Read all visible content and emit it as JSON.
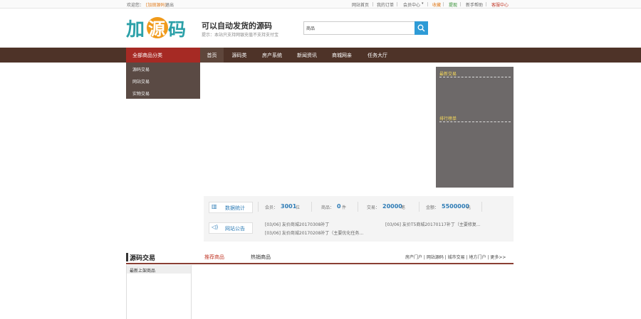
{
  "topbar": {
    "welcome": "欢迎您：",
    "username": "[加田源码]",
    "logout": "退出",
    "links": [
      "网站首页",
      "我的订单",
      "会员中心",
      "收藏",
      "提现",
      "新手帮助",
      "客服中心"
    ],
    "member_dropdown_icon": "caret-down-icon"
  },
  "header": {
    "logo_text": "加源码",
    "slogan": "可以自动发货的源码",
    "sub": "提示：本站只支持网银充值不支持支付宝",
    "search": {
      "category": "商品",
      "placeholder": "",
      "icon": "search-icon"
    }
  },
  "nav": {
    "category_head": "全部商品分类",
    "items": [
      "首页",
      "源码类",
      "房产系统",
      "新闻资讯",
      "商城网亲",
      "任务大厅"
    ],
    "categories": [
      "源码交易",
      "网站交易",
      "实物交易"
    ]
  },
  "side": {
    "latest": "最新交易",
    "rank": "排行榜单"
  },
  "stats": {
    "stats_label": "数据统计",
    "notice_label": "网站公告",
    "items": [
      {
        "label": "会员：",
        "value": "3001",
        "unit": "位"
      },
      {
        "label": "商品：",
        "value": "0",
        "unit": "件"
      },
      {
        "label": "交易：",
        "value": "20000",
        "unit": "笔"
      },
      {
        "label": "金额：",
        "value": "5500000",
        "unit": "元"
      }
    ],
    "notices": [
      "[03/06] 友价商城20170308补丁",
      "[03/06] 友价T5商城20170117补丁（主要修复...",
      "[03/06] 友价商城20170208补丁（主要优化任务..."
    ]
  },
  "section": {
    "title": "源码交易",
    "tabs": [
      "推荐商品",
      "热销商品"
    ],
    "links": "房产门户 | 网站源码 | 城市交易 | 地方门户 | 更多>>",
    "latest_head": "最新上架商品"
  },
  "colors": {
    "nav_bg": "#4e3328",
    "accent_red": "#a62a24",
    "blue": "#2e7cb6",
    "logo_orange": "#f09a1a"
  }
}
